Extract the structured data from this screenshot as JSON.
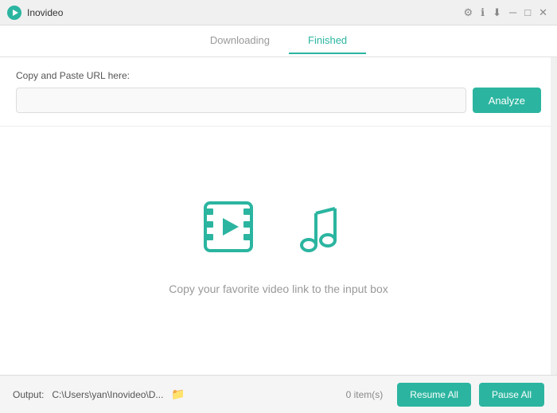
{
  "titleBar": {
    "appName": "Inovideo",
    "controls": [
      "settings",
      "info",
      "download",
      "minimize",
      "maximize",
      "close"
    ]
  },
  "tabs": [
    {
      "id": "downloading",
      "label": "Downloading",
      "active": false
    },
    {
      "id": "finished",
      "label": "Finished",
      "active": true
    }
  ],
  "urlArea": {
    "label": "Copy and Paste URL here:",
    "inputPlaceholder": "",
    "analyzeButtonLabel": "Analyze"
  },
  "emptyState": {
    "message": "Copy your favorite video link to the input box"
  },
  "bottomBar": {
    "outputLabel": "Output:",
    "outputPath": "C:\\Users\\yan\\Inovideo\\D...",
    "itemCount": "0 item(s)",
    "resumeAllLabel": "Resume All",
    "pauseAllLabel": "Pause All"
  }
}
